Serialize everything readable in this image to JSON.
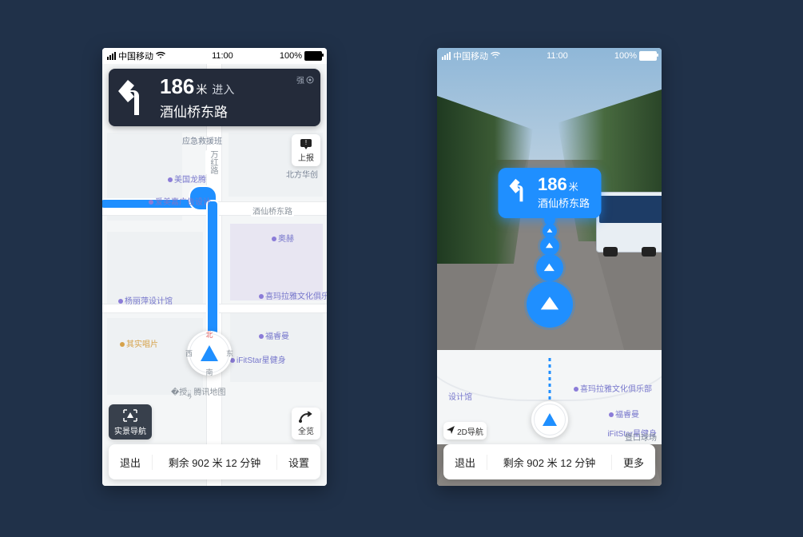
{
  "status": {
    "carrier": "中国移动",
    "time": "11:00",
    "battery": "100%"
  },
  "nav": {
    "distance": "186",
    "unit": "米",
    "action": "进入",
    "road": "酒仙桥东路",
    "signal_label": "强"
  },
  "left": {
    "report_label": "上报",
    "overview_label": "全览",
    "ar_nav_label": "实景导航",
    "compass": {
      "n": "北",
      "s": "南",
      "e": "东",
      "w": "西"
    },
    "brand": "腾讯地图",
    "bottom": {
      "exit": "退出",
      "remain": "剩余 902 米  12 分钟",
      "settings": "设置"
    },
    "roads": {
      "vertical": "万红路",
      "east": "酒仙桥东路"
    },
    "poi": {
      "rescue": "应急救援班",
      "meiguo": "美国龙腾",
      "aimeijia": "爱美嘉广告设计",
      "beifang": "北方华创",
      "aohe": "奥赫",
      "ximalaya": "喜玛拉雅文化俱乐部",
      "furuiman": "福睿曼",
      "fitstar": "iFitStar星健身",
      "yangliping": "杨丽萍设计馆",
      "qishi": "其实唱片"
    }
  },
  "right": {
    "mode_label": "2D导航",
    "bottom": {
      "exit": "退出",
      "remain": "剩余 902 米  12 分钟",
      "more": "更多"
    },
    "minimap_poi": {
      "sheji": "设计馆",
      "ximalaya": "喜玛拉雅文化俱乐部",
      "furuiman": "福睿曼",
      "fitstar": "iFitStar星健身",
      "other": "暨口球场"
    }
  }
}
